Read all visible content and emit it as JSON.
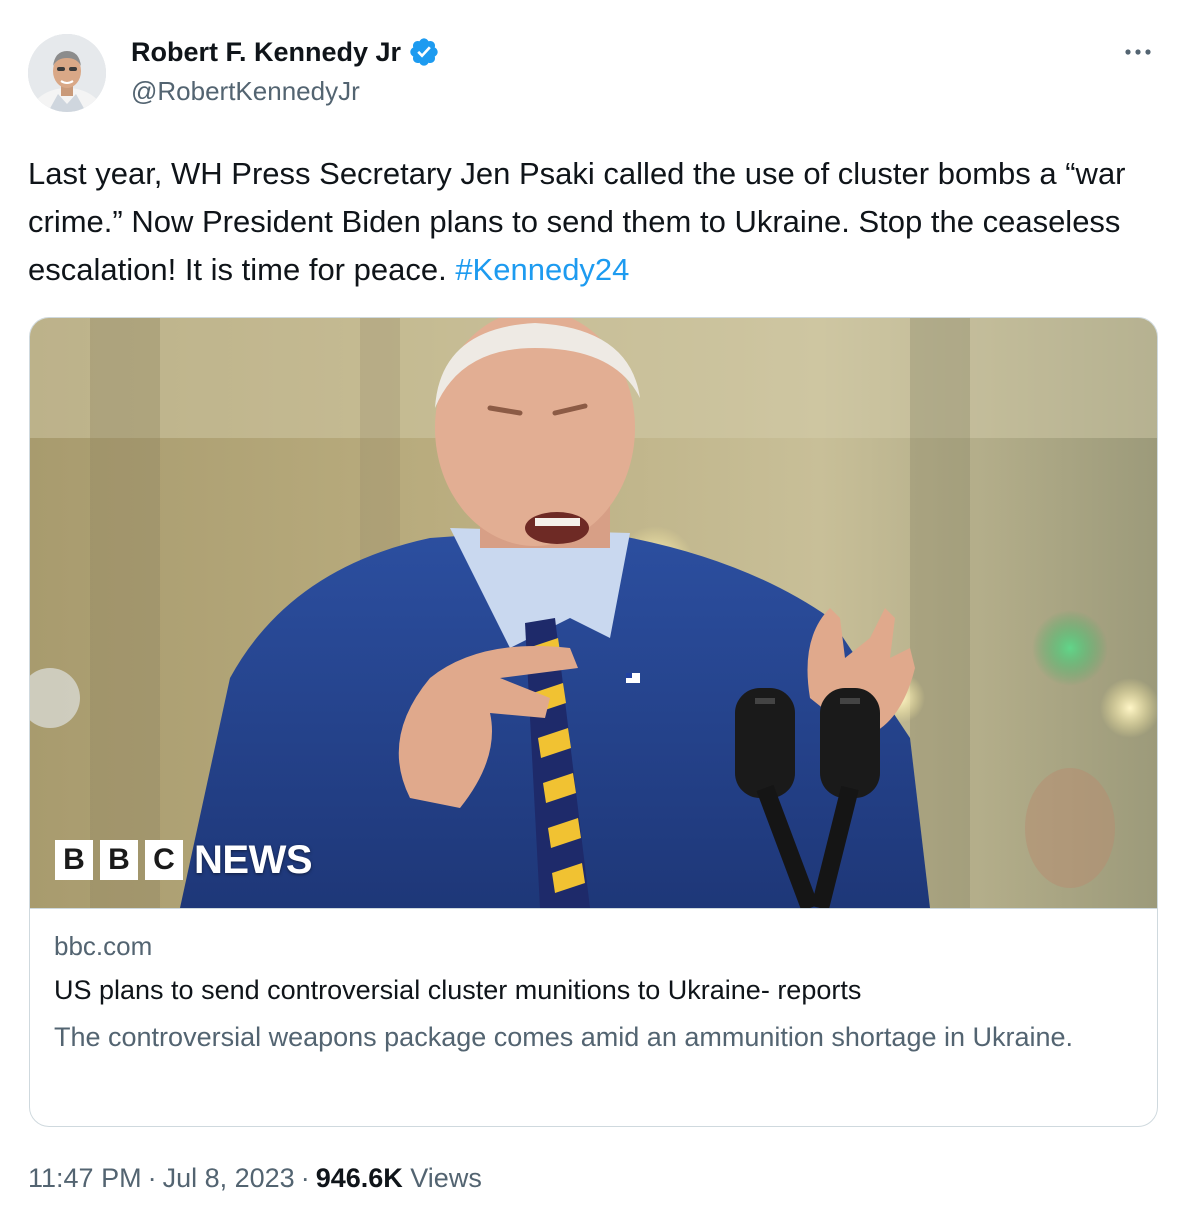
{
  "author": {
    "display_name": "Robert F. Kennedy Jr",
    "handle": "@RobertKennedyJr",
    "verified": true,
    "avatar_icon": "profile-photo"
  },
  "more_icon": "more-options-icon",
  "tweet": {
    "text_before": "Last year, WH Press Secretary Jen Psaki called the use of cluster bombs a “war crime.” Now President Biden plans to send them to Ukraine. Stop the ceaseless escalation! It is time for peace. ",
    "hashtag": "#Kennedy24"
  },
  "link_card": {
    "image_alt": "Photo of President Biden speaking at microphones",
    "logo": {
      "letters": [
        "B",
        "B",
        "C"
      ],
      "wordmark": "NEWS"
    },
    "domain": "bbc.com",
    "title": "US plans to send controversial cluster munitions to Ukraine- reports",
    "description": "The controversial weapons package comes amid an ammunition shortage in Ukraine."
  },
  "meta": {
    "time": "11:47 PM",
    "separator": "·",
    "date": "Jul 8, 2023",
    "views_count": "946.6K",
    "views_label": "Views"
  },
  "colors": {
    "text_primary": "#0f1419",
    "text_secondary": "#536471",
    "link": "#1d9bf0",
    "verified_badge": "#1d9bf0",
    "border": "#cfd9de"
  }
}
